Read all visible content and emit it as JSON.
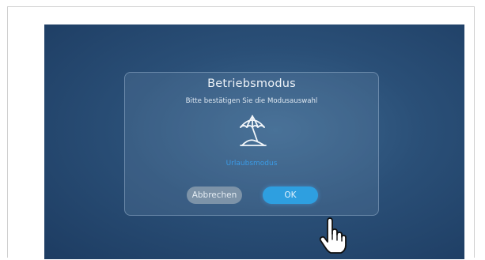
{
  "dialog": {
    "title": "Betriebsmodus",
    "subtitle": "Bitte bestätigen Sie die Modusauswahl",
    "mode_icon": "beach-umbrella-icon",
    "mode_label": "Urlaubsmodus",
    "cancel_label": "Abbrechen",
    "ok_label": "OK"
  },
  "pointer": {
    "icon": "hand-pointer-icon"
  },
  "colors": {
    "background_dark": "#1d3c62",
    "background_light": "#3d6890",
    "accent_blue": "#2e9fe0",
    "mode_label": "#3b9be6",
    "cancel_button": "#7d93a8"
  }
}
